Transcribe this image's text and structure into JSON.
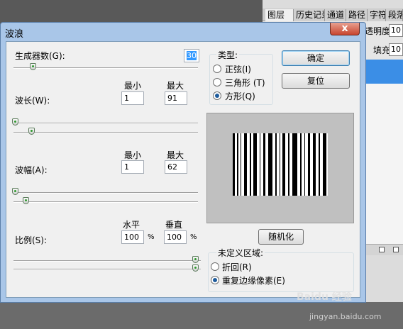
{
  "background": {
    "tabs": [
      "图层",
      "历史记录",
      "通道",
      "路径",
      "字符",
      "段落"
    ],
    "opacity_label": "透明度:",
    "opacity_value": "10",
    "fill_label": "填充:",
    "fill_value": "10"
  },
  "dialog": {
    "title": "波浪",
    "close_label": "x",
    "generators": {
      "label": "生成器数(G):",
      "value": "30",
      "level_percent": 10
    },
    "wavelength": {
      "label": "波长(W):",
      "min_label": "最小",
      "max_label": "最大",
      "min": "1",
      "max": "91",
      "min_level_percent": 0,
      "max_level_percent": 9
    },
    "amplitude": {
      "label": "波幅(A):",
      "min_label": "最小",
      "max_label": "最大",
      "min": "1",
      "max": "62",
      "min_level_percent": 0,
      "max_level_percent": 6
    },
    "scale": {
      "label": "比例(S):",
      "h_label": "水平",
      "v_label": "垂直",
      "h_value": "100",
      "v_value": "100",
      "unit": "%",
      "h_level_percent": 100,
      "v_level_percent": 100
    },
    "type": {
      "title": "类型:",
      "options": [
        {
          "label": "正弦(I)",
          "checked": false
        },
        {
          "label": "三角形 (T)",
          "checked": false
        },
        {
          "label": "方形(Q)",
          "checked": true
        }
      ]
    },
    "ok_label": "确定",
    "reset_label": "复位",
    "randomize_label": "随机化",
    "undefined": {
      "title": "未定义区域:",
      "options": [
        {
          "label": "折回(R)",
          "checked": false
        },
        {
          "label": "重复边缘像素(E)",
          "checked": true
        }
      ]
    }
  },
  "watermark": {
    "line1": "Baidu 经验",
    "line2": "jingyan.baidu.com"
  },
  "colors": {
    "accent": "#3b8ee6",
    "title_bg": "#a9c6e8",
    "client_bg": "#f0f0f0"
  }
}
